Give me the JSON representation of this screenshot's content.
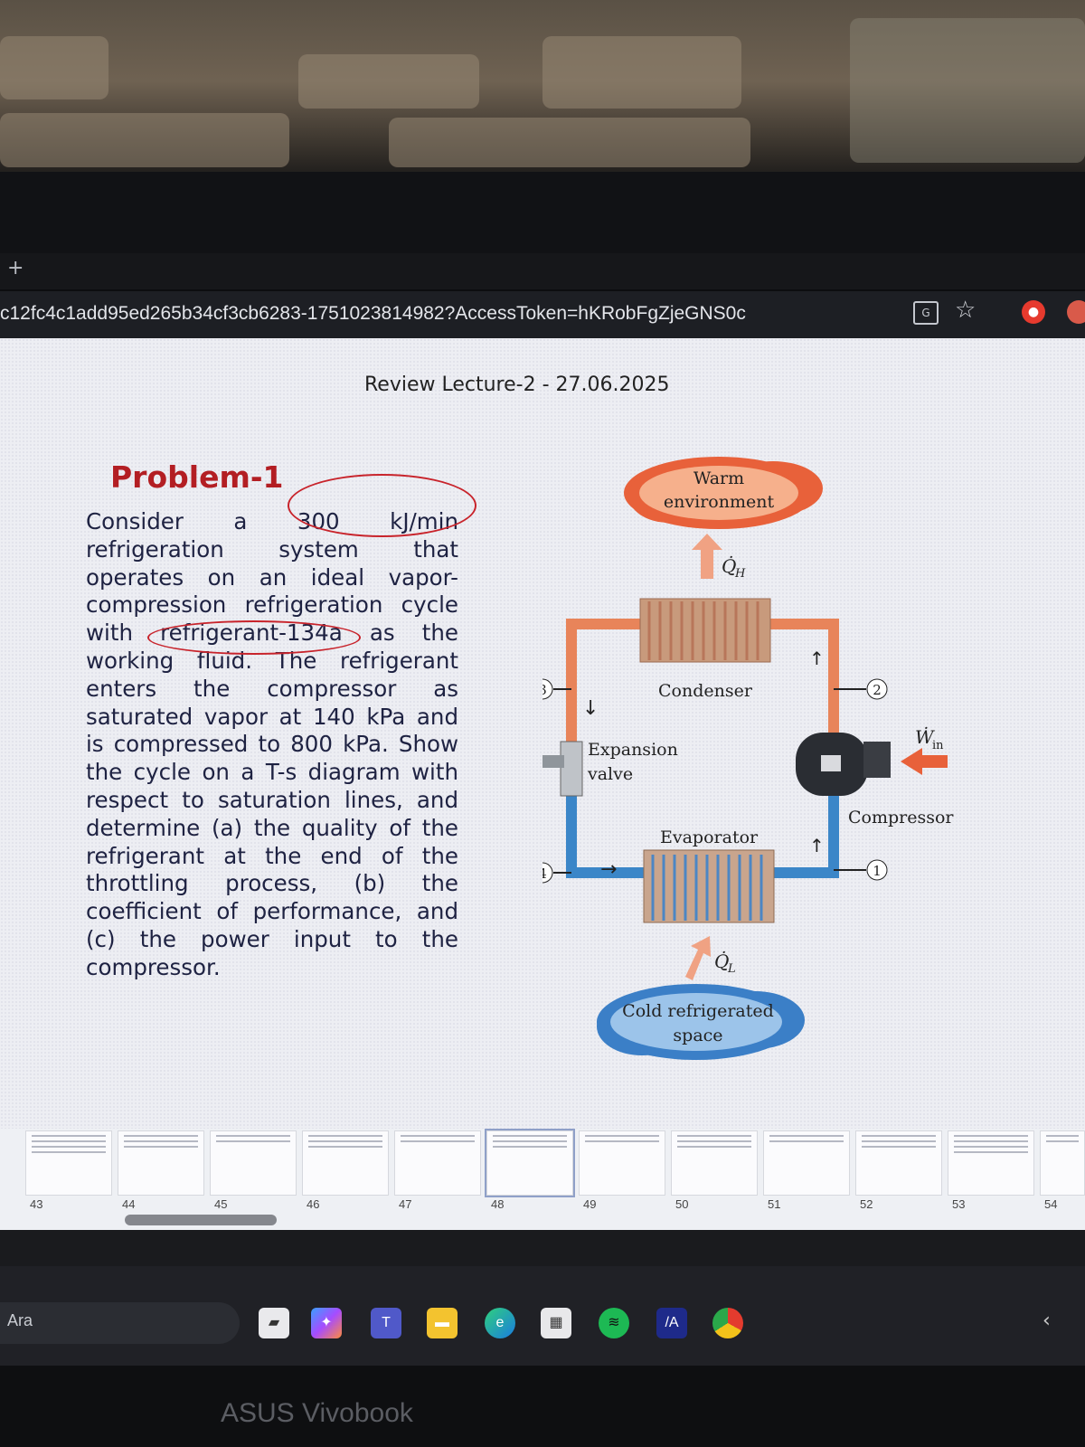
{
  "browser": {
    "new_tab_symbol": "+",
    "url": "c12fc4c1add95ed265b34cf3cb6283-1751023814982?AccessToken=hKRobFgZjeGNS0c",
    "icons": [
      "translate-icon",
      "star-icon",
      "extension-icon"
    ]
  },
  "slide": {
    "doc_title": "Review Lecture-2 - 27.06.2025",
    "problem_title": "Problem-1",
    "problem_text": "Consider a 300 kJ/min refrigeration system that operates on an ideal vapor-compression refrigeration cycle with refrigerant-134a as the working fluid. The refrigerant enters the compressor as saturated vapor at 140 kPa and is compressed to 800 kPa. Show the cycle on a T-s diagram with respect to saturation lines, and determine (a) the quality of the refrigerant at the end of the throttling process, (b) the coefficient of performance, and (c) the power input to the compressor.",
    "accent_color": "#b31e23"
  },
  "diagram": {
    "warm": "Warm environment",
    "cold": "Cold refrigerated space",
    "condenser": "Condenser",
    "evaporator": "Evaporator",
    "expansion_valve": "Expansion valve",
    "compressor": "Compressor",
    "q_h": "Q̇H",
    "q_l": "Q̇L",
    "w_in": "Ẇin",
    "state_1": "1",
    "state_2": "2",
    "state_3": "3",
    "state_4": "4"
  },
  "thumbnails": {
    "page_numbers": [
      "43",
      "44",
      "45",
      "46",
      "47",
      "48",
      "49",
      "50",
      "51",
      "52",
      "53",
      "54"
    ],
    "selected": "48"
  },
  "taskbar": {
    "search_text": "Ara",
    "apps": [
      "file-explorer-icon",
      "copilot-icon",
      "teams-icon",
      "folder-icon",
      "edge-icon",
      "store-icon",
      "spotify-icon",
      "meta-icon",
      "chrome-icon"
    ],
    "brand": "ASUS Vivobook"
  }
}
